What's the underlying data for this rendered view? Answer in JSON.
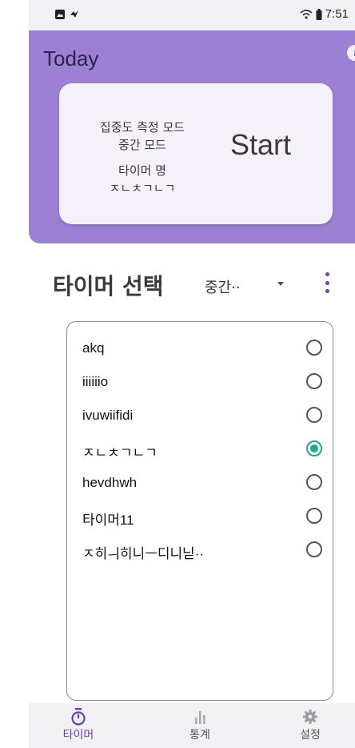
{
  "status_bar": {
    "time": "7:51",
    "left_icons": [
      "gallery-icon",
      "messenger-icon"
    ],
    "right_icons": [
      "wifi-icon",
      "battery-icon"
    ]
  },
  "header": {
    "title": "Today",
    "info_label": "i",
    "card": {
      "mode_line": "집중도 측정 모드",
      "mode_value": "중간 모드",
      "timer_label": "타이머 명",
      "timer_name": "ㅈㄴㅊㄱㄴㄱ",
      "start_label": "Start"
    }
  },
  "select": {
    "title": "타이머 선택",
    "value": "중간··"
  },
  "timers": [
    {
      "label": "akq",
      "selected": false
    },
    {
      "label": "iiiiiio",
      "selected": false
    },
    {
      "label": "ivuwiifidi",
      "selected": false
    },
    {
      "label": "ㅈㄴㅊㄱㄴㄱ",
      "selected": true
    },
    {
      "label": "hevdhwh",
      "selected": false
    },
    {
      "label": "타이머11",
      "selected": false
    },
    {
      "label": "ㅈ히ㅢ히니ㅡ디니닏··",
      "selected": false
    }
  ],
  "bottom_nav": {
    "timer_label": "타이머",
    "stats_label": "통계",
    "settings_label": "설정",
    "active": "timer"
  },
  "colors": {
    "header_bg": "#9c80d4",
    "accent": "#6b3fb6",
    "radio_selected": "#1aa898"
  }
}
